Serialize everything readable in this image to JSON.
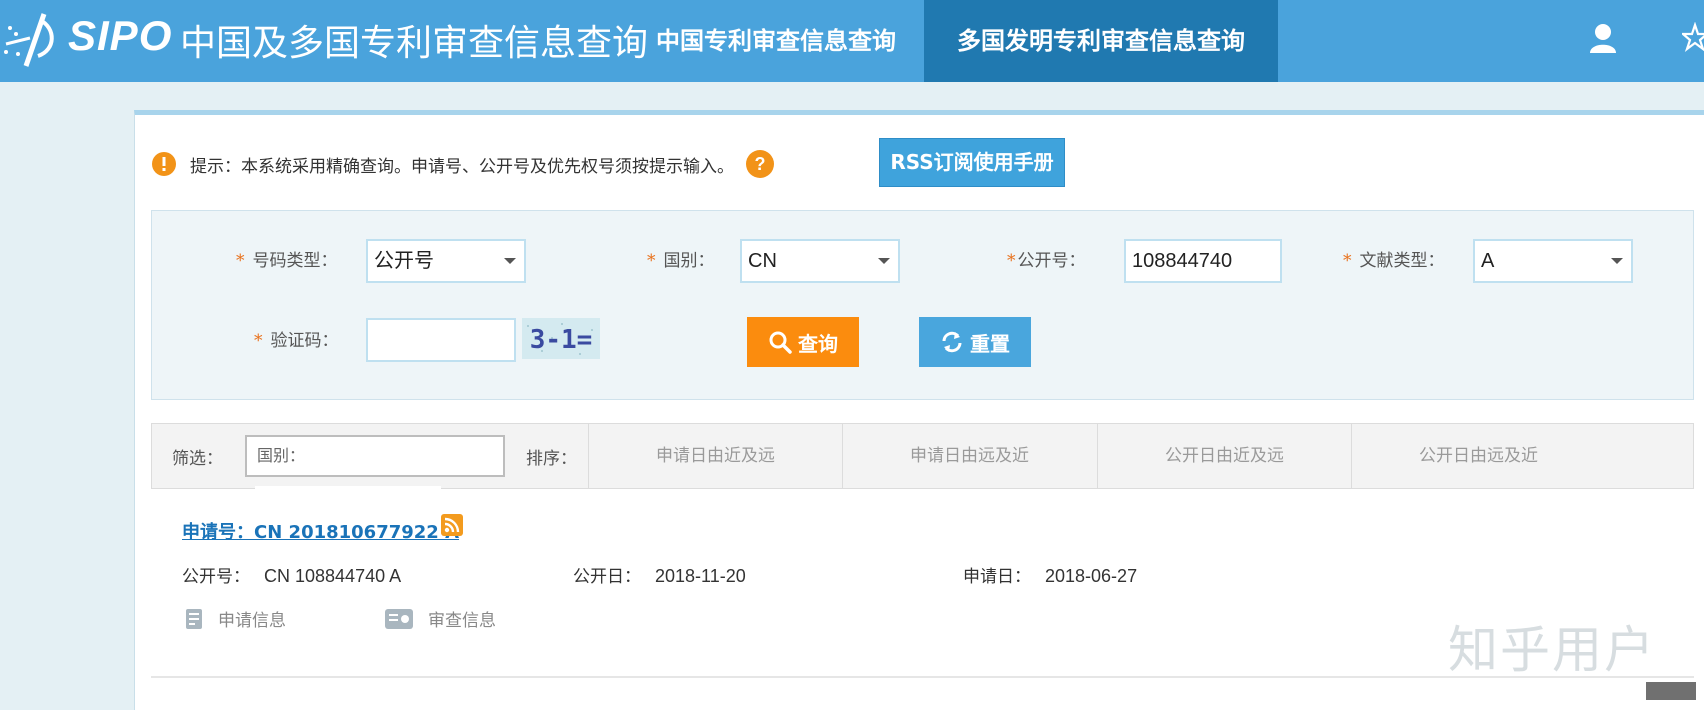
{
  "header": {
    "logo_text": "SIPO",
    "site_title": "中国及多国专利审查信息查询",
    "tabs": [
      {
        "label": "中国专利审查信息查询"
      },
      {
        "label": "多国发明专利审查信息查询"
      }
    ],
    "accent": "#4aa3dc",
    "active_tab_color": "#2079b0"
  },
  "notice": {
    "text": "提示：本系统采用精确查询。申请号、公开号及优先权号须按提示输入。",
    "rss_button": "RSS订阅使用手册"
  },
  "form": {
    "number_type": {
      "label": "号码类型：",
      "value": "公开号"
    },
    "country": {
      "label": "国别：",
      "value": "CN"
    },
    "pub_number": {
      "label": "公开号：",
      "value": "108844740"
    },
    "doc_type": {
      "label": "文献类型：",
      "value": "A"
    },
    "captcha": {
      "label": "验证码：",
      "value": "",
      "image_text": "3-1="
    },
    "query_button": "查询",
    "reset_button": "重置"
  },
  "filter": {
    "filter_label": "筛选：",
    "country_placeholder": "国别：",
    "sort_label": "排序：",
    "sort_options": [
      "申请日由近及远",
      "申请日由远及近",
      "公开日由近及远",
      "公开日由远及近"
    ]
  },
  "result": {
    "app_link": "申请号：CN 201810677922 A",
    "pub_no_label": "公开号：",
    "pub_no": "CN 108844740 A",
    "pub_date_label": "公开日：",
    "pub_date": "2018-11-20",
    "app_date_label": "申请日：",
    "app_date": "2018-06-27",
    "actions": [
      "申请信息",
      "审查信息"
    ]
  },
  "watermark": "知乎用户"
}
